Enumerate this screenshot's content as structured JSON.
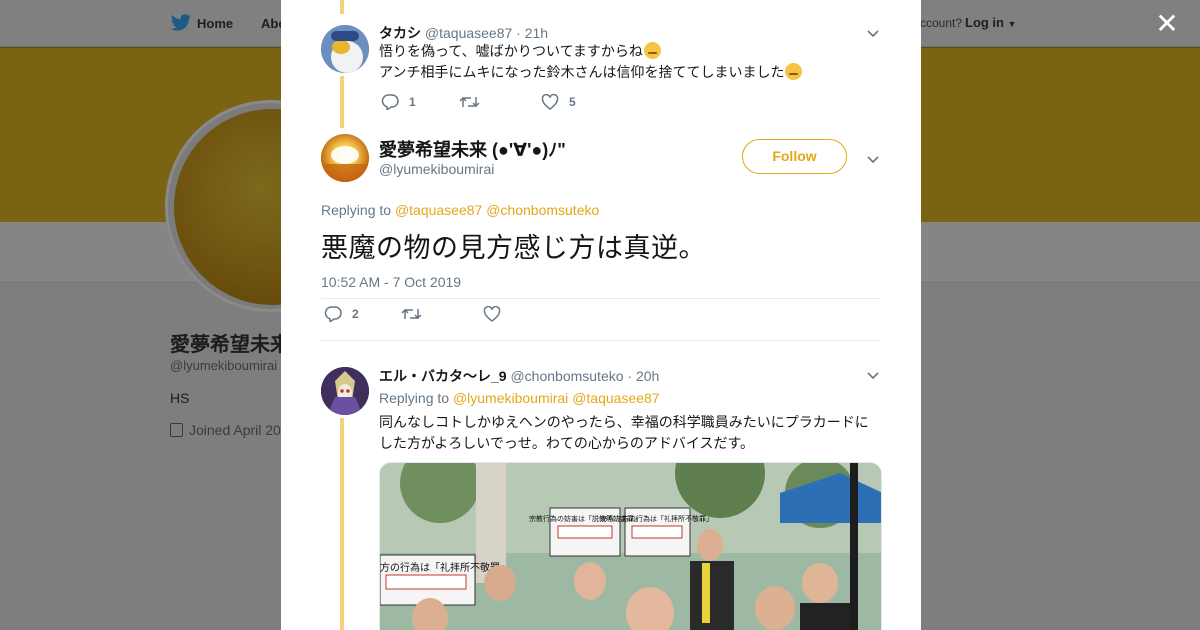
{
  "background": {
    "nav": {
      "home": "Home",
      "about": "Abo",
      "have_account": "ccount?",
      "login": "Log in"
    },
    "profile": {
      "name": "愛夢希望未来",
      "handle": "@lyumekiboumirai",
      "bio": "HS",
      "joined": "Joined April 20"
    }
  },
  "modal": {
    "tweet1": {
      "name": "タカシ",
      "handle": "@taquasee87",
      "time": "· 21h",
      "line1": "悟りを偽って、嘘ばかりついてますからね",
      "line2": "アンチ相手にムキになった鈴木さんは信仰を捨ててしまいました",
      "replies": "1",
      "retweets": "",
      "likes": "5"
    },
    "main": {
      "name": "愛夢希望未来 (●'∀'●)ﾉ\"",
      "handle": "@lyumekiboumirai",
      "follow_label": "Follow",
      "replying_to_label": "Replying to",
      "replying_to_1": "@taquasee87",
      "replying_to_2": "@chonbomsuteko",
      "text": "悪魔の物の見方感じ方は真逆。",
      "timestamp": "10:52 AM - 7 Oct 2019",
      "replies": "2",
      "retweets": "",
      "likes": ""
    },
    "tweet3": {
      "name": "エル・バカタ～レ_9",
      "handle": "@chonbomsuteko",
      "time": "· 20h",
      "replying_to_label": "Replying to",
      "replying_to_1": "@lyumekiboumirai",
      "replying_to_2": "@taquasee87",
      "line1": "同んなしコトしかゆえヘンのやったら、幸福の科学職員みたいにプラカードに",
      "line2": "した方がよろしいでっせ。わての心からのアドバイスだす。",
      "media_sign1": "あなた方の行為は「礼拝所不敬罪」",
      "media_sign2": "宗教行為の妨害は「説教等妨害罪」",
      "media_sign3": "あなた方の行為は「礼拝所不敬罪」"
    }
  },
  "colors": {
    "accent": "#e5a71a",
    "thread_line": "#f5d27a",
    "muted": "#657786",
    "text": "#14171a",
    "overlay": "#7e7e7e"
  },
  "icons": [
    "twitter-bird-icon",
    "close-icon",
    "chevron-down-icon",
    "reply-icon",
    "retweet-icon",
    "like-icon",
    "calendar-icon"
  ]
}
